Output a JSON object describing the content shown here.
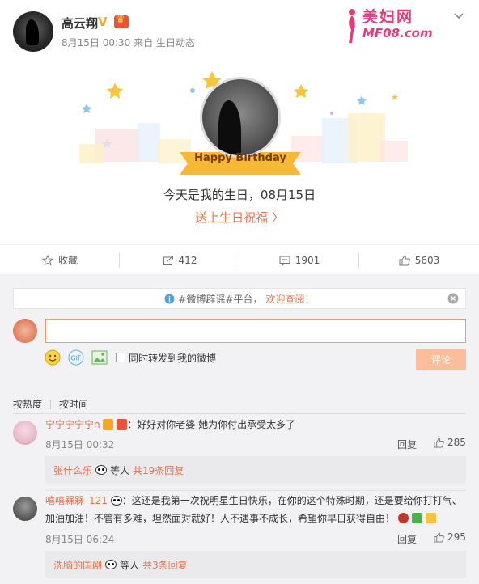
{
  "watermark": {
    "title": "美妇网",
    "subtitle": "MF08.com"
  },
  "post": {
    "author": "高云翔",
    "verified_mark": "V",
    "meta": "8月15日 00:30 来自 生日动态"
  },
  "card": {
    "ribbon_text": "Happy Birthday",
    "message": "今天是我的生日，08月15日",
    "link": "送上生日祝福 〉"
  },
  "actions": [
    {
      "label": "收藏",
      "icon": "star-icon"
    },
    {
      "label": "412",
      "icon": "forward-icon"
    },
    {
      "label": "1901",
      "icon": "comment-icon"
    },
    {
      "label": "5603",
      "icon": "like-icon"
    }
  ],
  "notice": {
    "prefix": "#微博辟谣#平台，",
    "link": "欢迎查阅！"
  },
  "composer": {
    "input_value": "",
    "forward_label": "同时转发到我的微博",
    "submit_label": "评论"
  },
  "sort": {
    "hot": "按热度",
    "time": "按时间"
  },
  "comments": [
    {
      "user": "宁宁宁宁宁n",
      "text": "：好好对你老婆 她为你付出承受太多了",
      "time": "8月15日 00:32",
      "reply": "回复",
      "likes": "285",
      "sub_user": "张什么乐",
      "sub_mid": "等人",
      "sub_count": "共19条回复"
    },
    {
      "user": "嘻嘻槑槑_121",
      "text_line1": "：这还是我第一次祝明星生日快乐，在你的这个特殊时期，还是要给你打打气、",
      "text_line2": "加油加油！不管有多难，坦然面对就好！人不遇事不成长，希望你早日获得自由！",
      "time": "8月15日 06:24",
      "reply": "回复",
      "likes": "295",
      "sub_user": "洗脑的国剧",
      "sub_mid": "等人",
      "sub_count": "共3条回复"
    }
  ],
  "colors": {
    "accent": "#eb7350",
    "submit": "#fbbd9b",
    "panel": "#f2f2f5",
    "verified": "#f5a623"
  }
}
